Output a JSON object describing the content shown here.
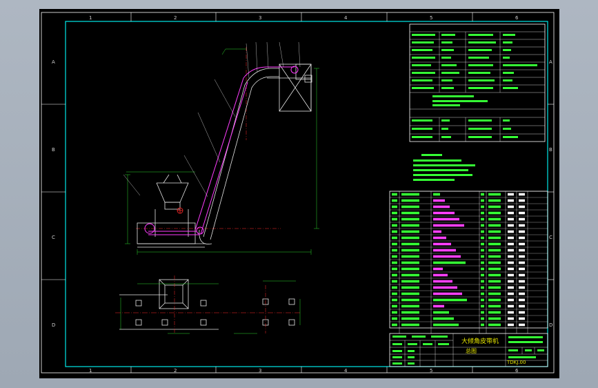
{
  "drawing": {
    "title": "大倾角皮带机",
    "subtitle": "总图",
    "drawing_number": "TDKJ.00"
  },
  "frame": {
    "columns": [
      "1",
      "2",
      "3",
      "4",
      "5",
      "6"
    ],
    "rows": [
      "A",
      "B",
      "C",
      "D"
    ]
  },
  "colors": {
    "background": "#000000",
    "frame_line": "#00e8e8",
    "table_line": "#ffffff",
    "text_green": "#35ff35",
    "text_magenta": "#ff40ff",
    "title_yellow": "#e8e800",
    "machine_white": "#e8e8e8",
    "belt_magenta": "#ff3cff",
    "center_red": "#ff2a2a",
    "dim_green": "#2cd82c"
  },
  "parts_list_rows": 22
}
